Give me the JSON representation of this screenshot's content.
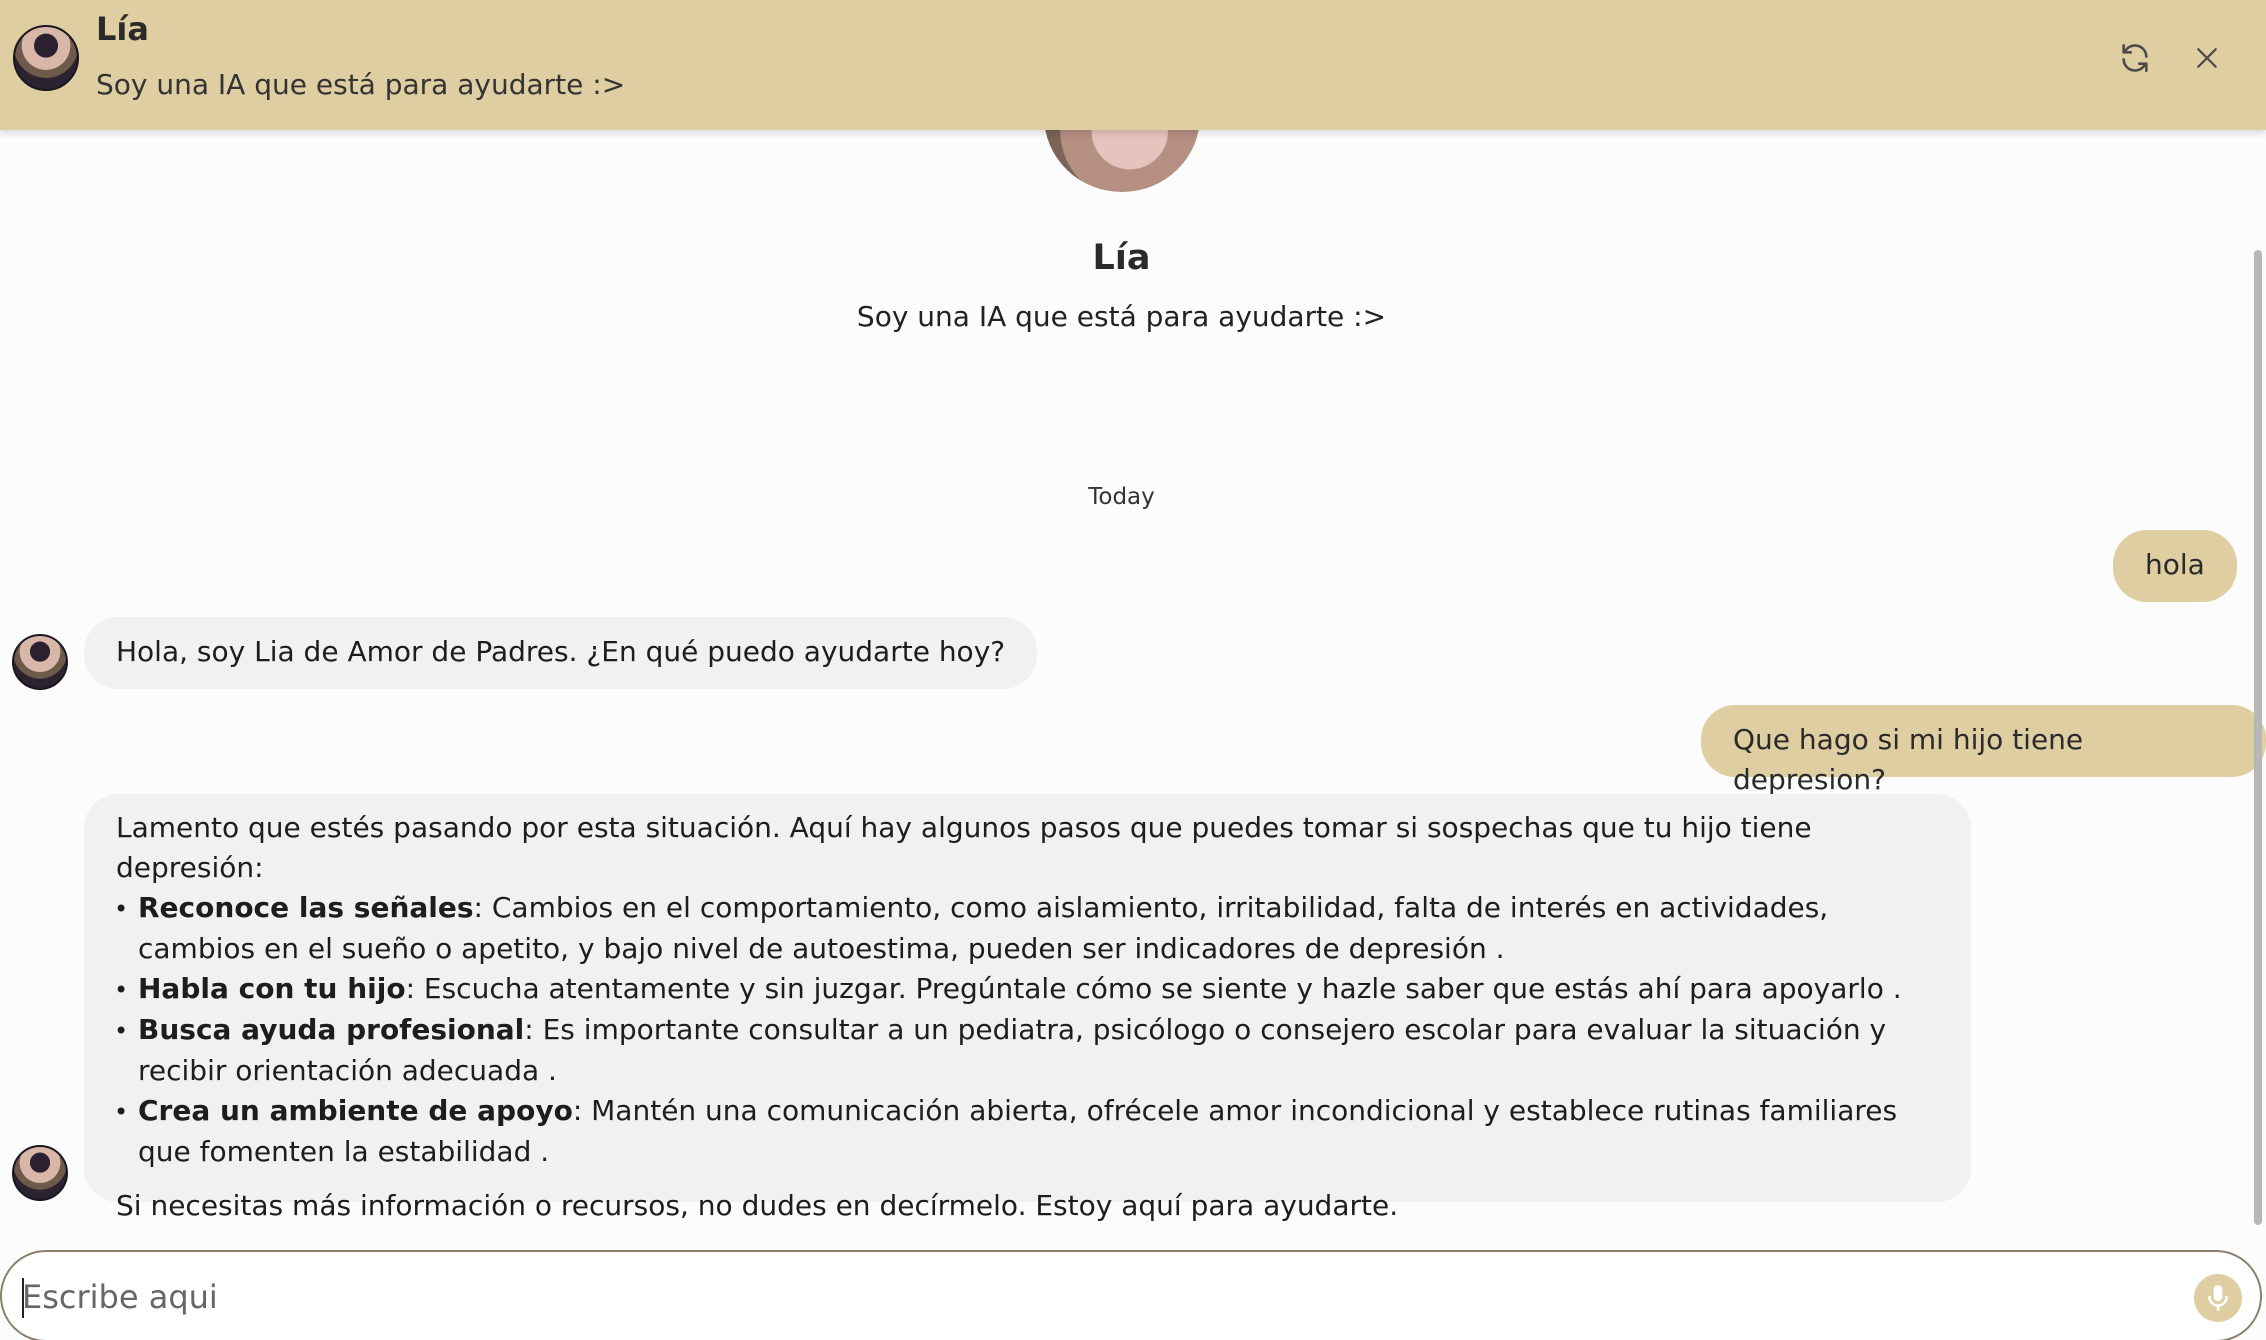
{
  "header": {
    "name": "Lía",
    "subtitle": "Soy una IA que está para ayudarte :>",
    "refresh_icon": "refresh-icon",
    "close_icon": "close-icon"
  },
  "profile": {
    "name": "Lía",
    "description": "Soy una IA que está para ayudarte :>"
  },
  "date_separator": "Today",
  "messages": [
    {
      "from": "user",
      "text": "hola"
    },
    {
      "from": "bot",
      "text": "Hola, soy Lia de Amor de Padres. ¿En qué puedo ayudarte hoy?"
    },
    {
      "from": "user",
      "text": "Que hago si mi hijo tiene depresion?"
    },
    {
      "from": "bot",
      "intro": "Lamento que estés pasando por esta situación. Aquí hay algunos pasos que puedes tomar si sospechas que tu hijo tiene depresión:",
      "items": [
        {
          "title": "Reconoce las señales",
          "text": ": Cambios en el comportamiento, como aislamiento, irritabilidad, falta de interés en actividades, cambios en el sueño o apetito, y bajo nivel de autoestima, pueden ser indicadores de depresión ."
        },
        {
          "title": "Habla con tu hijo",
          "text": ": Escucha atentamente y sin juzgar. Pregúntale cómo se siente y hazle saber que estás ahí para apoyarlo ."
        },
        {
          "title": "Busca ayuda profesional",
          "text": ": Es importante consultar a un pediatra, psicólogo o consejero escolar para evaluar la situación y recibir orientación adecuada ."
        },
        {
          "title": "Crea un ambiente de apoyo",
          "text": ": Mantén una comunicación abierta, ofrécele amor incondicional y establece rutinas familiares que fomenten la estabilidad ."
        }
      ],
      "bullet": "•",
      "outro": "Si necesitas más información o recursos, no dudes en decírmelo. Estoy aquí para ayudarte."
    }
  ],
  "input": {
    "placeholder": "Escribe aqui",
    "value": "",
    "mic_icon": "microphone-icon"
  },
  "colors": {
    "accent": "#dfcea2",
    "bot_bubble": "#f1f1f0",
    "background": "#fcfcfc"
  }
}
